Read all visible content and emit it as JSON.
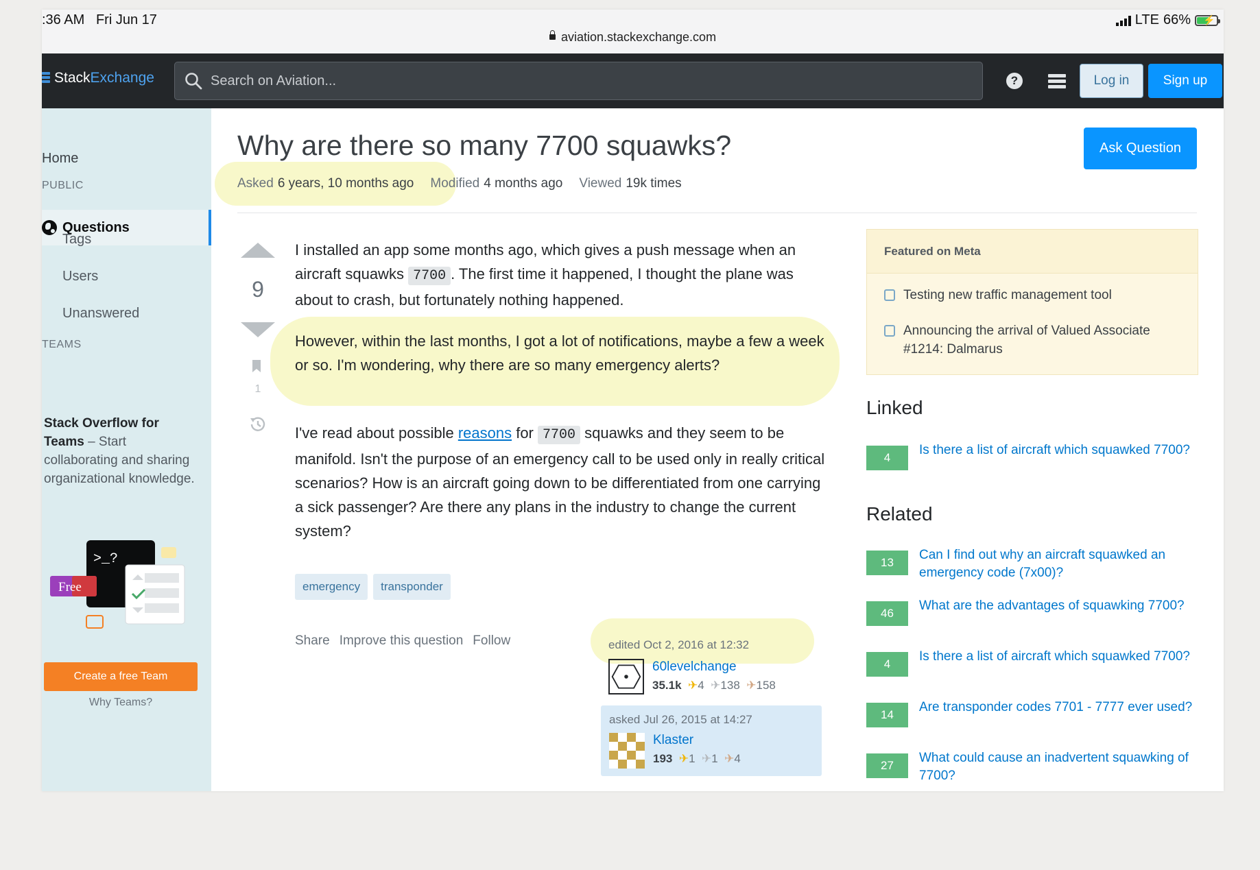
{
  "status": {
    "time": ":36 AM",
    "date": "Fri Jun 17",
    "network": "LTE",
    "battery": "66%",
    "battery_level": 0.66,
    "url": "aviation.stackexchange.com"
  },
  "topbar": {
    "logo_stack": "Stack",
    "logo_exchange": "Exchange",
    "search_placeholder": "Search on Aviation...",
    "login": "Log in",
    "signup": "Sign up"
  },
  "nav": {
    "home": "Home",
    "public_heading": "PUBLIC",
    "questions": "Questions",
    "tags": "Tags",
    "users": "Users",
    "unanswered": "Unanswered",
    "teams_heading": "TEAMS",
    "teams_title": "Stack Overflow for Teams",
    "teams_rest": " – Start collaborating and sharing organizational knowledge.",
    "illus_prompt": ">_?",
    "illus_free": "Free",
    "create_team": "Create a free Team",
    "why_teams": "Why Teams?"
  },
  "question": {
    "title": "Why are there so many 7700 squawks?",
    "ask_button": "Ask Question",
    "asked_label": "Asked",
    "asked_value": "6 years, 10 months ago",
    "modified_label": "Modified",
    "modified_value": "4 months ago",
    "viewed_label": "Viewed",
    "viewed_value": "19k times",
    "votes": "9",
    "bookmarks": "1",
    "p1_a": "I installed an app some months ago, which gives a push message when an aircraft squawks ",
    "p1_code": "7700",
    "p1_b": ". The first time it happened, I thought the plane was about to crash, but fortunately nothing happened.",
    "p2": "However, within the last months, I got a lot of notifications, maybe a few a week or so. I'm wondering, why there are so many emergency alerts?",
    "p3_a": "I've read about possible ",
    "p3_link": "reasons",
    "p3_b": " for ",
    "p3_code": "7700",
    "p3_c": " squawks and they seem to be manifold. Isn't the purpose of an emergency call to be used only in really critical scenarios? How is an aircraft going down to be differentiated from one carrying a sick passenger? Are there any plans in the industry to change the current system?",
    "tags": [
      "emergency",
      "transponder"
    ],
    "share": "Share",
    "improve": "Improve this question",
    "follow": "Follow",
    "edited": "edited Oct 2, 2016 at 12:32",
    "editor_name": "60levelchange",
    "editor_rep": "35.1k",
    "editor_gold": "4",
    "editor_silver": "138",
    "editor_bronze": "158",
    "asked_when": "asked Jul 26, 2015 at 14:27",
    "asker_name": "Klaster",
    "asker_rep": "193",
    "asker_gold": "1",
    "asker_silver": "1",
    "asker_bronze": "4"
  },
  "sidebar": {
    "meta_heading": "Featured on Meta",
    "meta_items": [
      "Testing new traffic management tool",
      "Announcing the arrival of Valued Associate #1214: Dalmarus"
    ],
    "linked_heading": "Linked",
    "linked": [
      {
        "count": "4",
        "title": "Is there a list of aircraft which squawked 7700?"
      }
    ],
    "related_heading": "Related",
    "related": [
      {
        "count": "13",
        "title": "Can I find out why an aircraft squawked an emergency code (7x00)?"
      },
      {
        "count": "46",
        "title": "What are the advantages of squawking 7700?"
      },
      {
        "count": "4",
        "title": "Is there a list of aircraft which squawked 7700?"
      },
      {
        "count": "14",
        "title": "Are transponder codes 7701 - 7777 ever used?"
      },
      {
        "count": "27",
        "title": "What could cause an inadvertent squawking of 7700?"
      }
    ]
  },
  "colors": {
    "accent": "#0a95ff",
    "topbar": "#232629",
    "highlight": "#f4f4a6",
    "answered_count": "#5eba7d",
    "team_button": "#f48024"
  }
}
